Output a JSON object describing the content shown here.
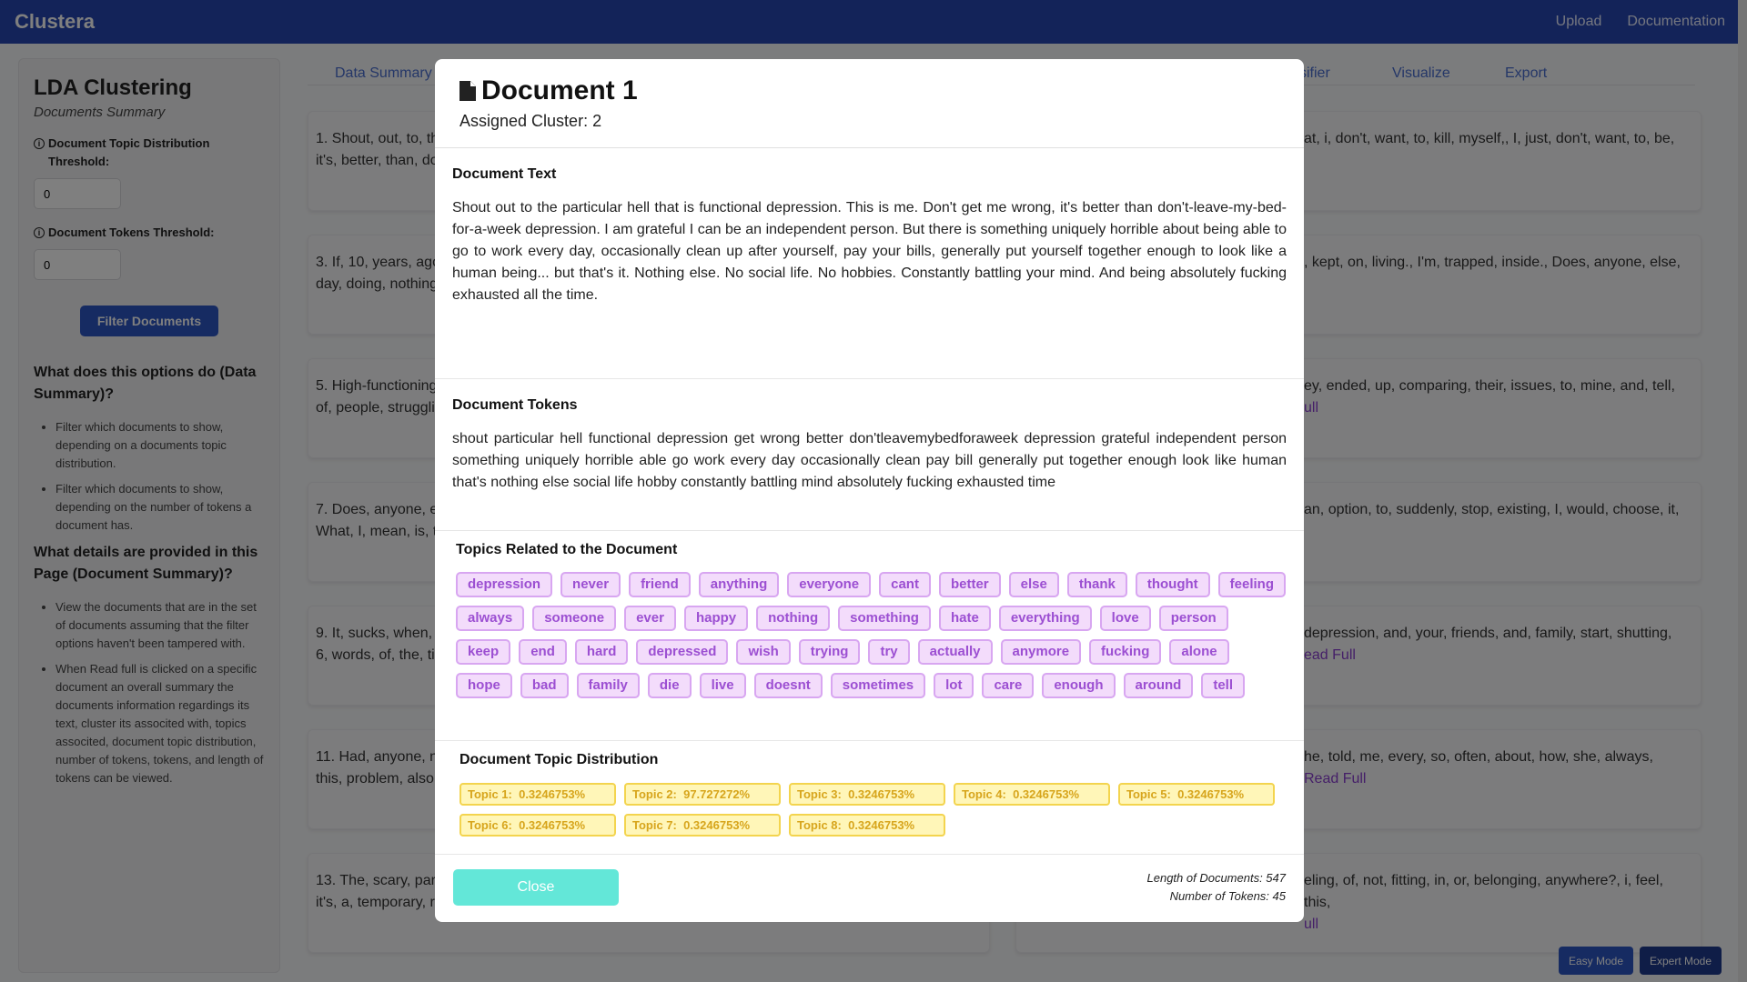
{
  "navbar": {
    "brand": "Clustera",
    "links": [
      "Upload",
      "Documentation"
    ]
  },
  "sidebar": {
    "title": "LDA Clustering",
    "subtitle": "Documents Summary",
    "threshold_label": "Document Topic Distribution Threshold:",
    "threshold_value": "0",
    "tokens_label": "Document Tokens Threshold:",
    "tokens_value": "0",
    "filter_button": "Filter Documents",
    "q1": "What does this options do (Data Summary)?",
    "q1_items": [
      "Filter which documents to show, depending on a documents topic distribution.",
      "Filter which documents to show, depending on the number of tokens a document has."
    ],
    "q2": "What details are provided in this Page (Document Summary)?",
    "q2_items": [
      "View the documents that are in the set of documents assuming that the filter options haven't been tampered with.",
      "When Read full is clicked on a specific document an overall summary the documents information regardings its text, cluster its associted with, topics associted, document topic distribution, number of tokens, tokens, and length of tokens can be viewed."
    ]
  },
  "tabs": {
    "data_summary": "Data Summary",
    "classifier_fragment": "sifier",
    "visualize": "Visualize",
    "export": "Export"
  },
  "background_cards": [
    {
      "left": "1. Shout, out, to, th",
      "left2": "it's, better, than, do",
      "right": "at, i, don't, want, to, kill, myself,, I, just, don't, want, to, be,",
      "right2": ""
    },
    {
      "left": "3. If, 10, years, ago,",
      "left2": "day, doing, nothing",
      "right": ", kept, on, living., I'm, trapped, inside., Does, anyone, else,",
      "right2": ""
    },
    {
      "left": "5. High-functioning",
      "left2": "of, people, struggli",
      "right": "ey, ended, up, comparing, their, issues, to, mine, and, tell,",
      "right2": "ull"
    },
    {
      "left": "7. Does, anyone, els",
      "left2": "What, I, mean, is, th",
      "right": "an, option, to, suddenly, stop, existing, I, would, choose, it,",
      "right2": ""
    },
    {
      "left": "9. It, sucks, when, y",
      "left2": "6, words, of, the, tit",
      "right": "depression, and, your, friends, and, family, start, shutting,",
      "right2": "ead Full"
    },
    {
      "left": "11. Had, anyone, no",
      "left2": "this, problem, also,",
      "right": "he, told, me, every, so, often, about, how, she, always,",
      "right2": " Read Full"
    },
    {
      "left": "13. The, scary, part,",
      "left2": "it's, a, temporary, re",
      "right": "eling, of, not, fitting, in, or, belonging, anywhere?, i, feel, this,",
      "right2": "ull"
    }
  ],
  "modal": {
    "title": "Document 1",
    "assigned_cluster": "Assigned Cluster: 2",
    "doc_text_title": "Document Text",
    "doc_text": "Shout out to the particular hell that is functional depression. This is me. Don't get me wrong, it's better than don't-leave-my-bed-for-a-week depression. I am grateful I can be an independent person. But there is something uniquely horrible about being able to go to work every day, occasionally clean up after yourself, pay your bills, generally put yourself together enough to look like a human being... but that's it. Nothing else. No social life. No hobbies. Constantly battling your mind. And being absolutely fucking exhausted all the time.",
    "tokens_title": "Document Tokens",
    "tokens_text": "shout particular hell functional depression get wrong better don'tleavemybedforaweek depression grateful independent person something uniquely horrible able go work every day occasionally clean pay bill generally put together enough look like human that's nothing else social life hobby constantly battling mind absolutely fucking exhausted time",
    "topics_title": "Topics Related to the Document",
    "topics": [
      "depression",
      "never",
      "friend",
      "anything",
      "everyone",
      "cant",
      "better",
      "else",
      "thank",
      "thought",
      "feeling",
      "always",
      "someone",
      "ever",
      "happy",
      "nothing",
      "something",
      "hate",
      "everything",
      "love",
      "person",
      "keep",
      "end",
      "hard",
      "depressed",
      "wish",
      "trying",
      "try",
      "actually",
      "anymore",
      "fucking",
      "alone",
      "hope",
      "bad",
      "family",
      "die",
      "live",
      "doesnt",
      "sometimes",
      "lot",
      "care",
      "enough",
      "around",
      "tell"
    ],
    "distribution_title": "Document Topic Distribution",
    "distribution": [
      "Topic 1:  0.3246753%",
      "Topic 2:  97.727272%",
      "Topic 3:  0.3246753%",
      "Topic 4:  0.3246753%",
      "Topic 5:  0.3246753%",
      "Topic 6:  0.3246753%",
      "Topic 7:  0.3246753%",
      "Topic 8:  0.3246753%"
    ],
    "close_button": "Close",
    "length_label": "Length of Documents: 547",
    "tokens_count_label": "Number of Tokens: 45"
  },
  "mode_buttons": {
    "easy": "Easy Mode",
    "expert": "Expert Mode"
  },
  "colors": {
    "navbar": "#2747b3",
    "tag_bg": "#f3dcfb",
    "tag_text": "#9c4fd2",
    "topic_bg": "#fff6b8",
    "topic_text": "#d7a51c",
    "close": "#63e7d8"
  }
}
